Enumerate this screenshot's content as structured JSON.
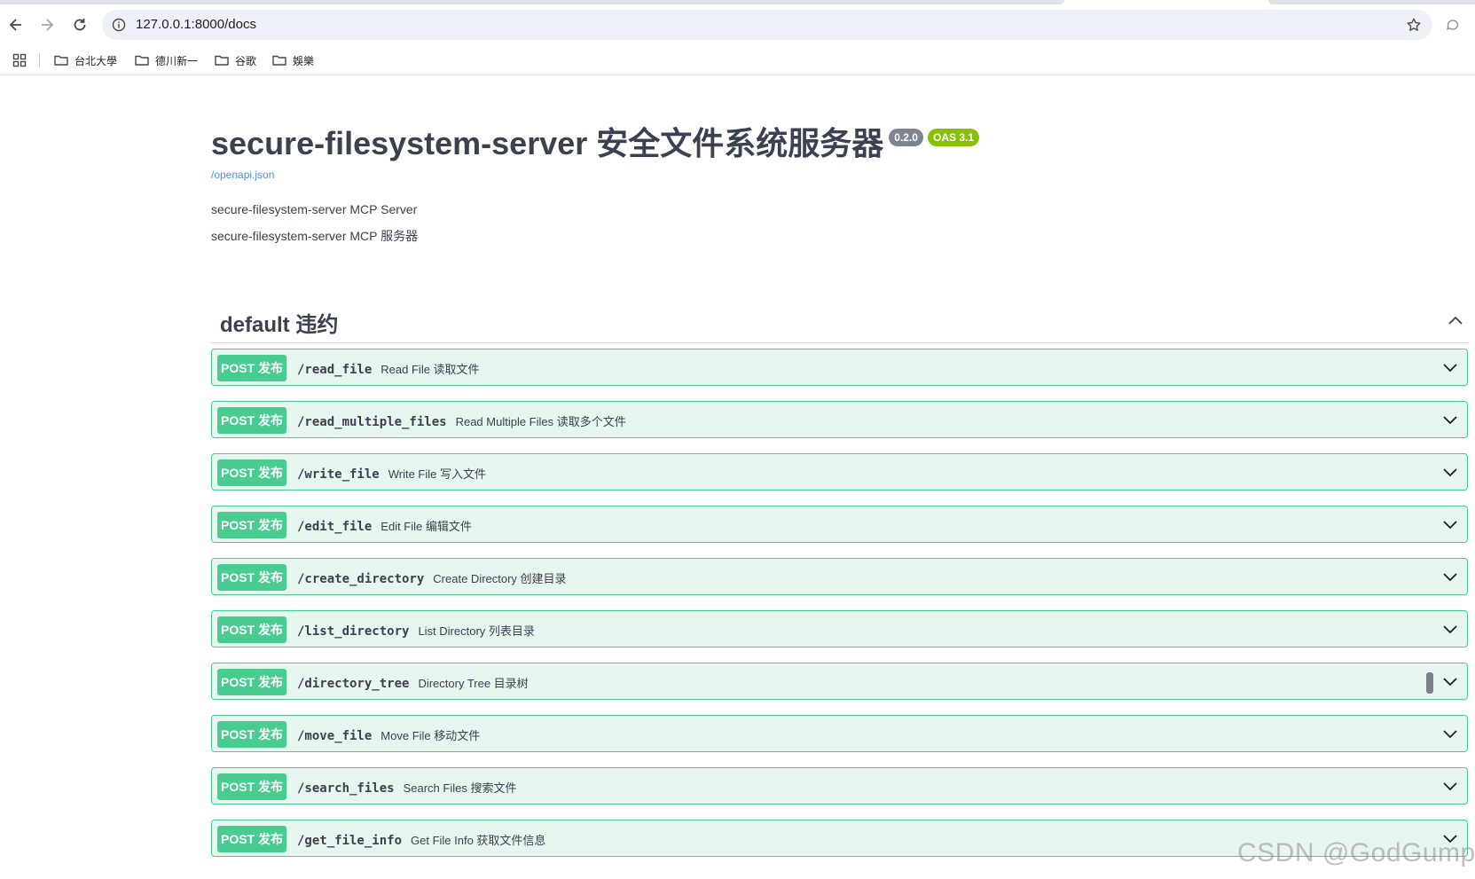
{
  "browser": {
    "url": "127.0.0.1:8000/docs",
    "bookmarks": [
      {
        "label": "台北大學"
      },
      {
        "label": "德川新一"
      },
      {
        "label": "谷歌"
      },
      {
        "label": "娛樂"
      }
    ]
  },
  "page": {
    "title": "secure-filesystem-server  安全文件系统服务器",
    "version_badge": "0.2.0",
    "oas_badge": "OAS 3.1",
    "openapi_link": "/openapi.json",
    "description_line1": "secure-filesystem-server MCP Server",
    "description_line2": "secure-filesystem-server MCP 服务器",
    "section_title": "default  违约"
  },
  "operations": [
    {
      "method": "POST 发布",
      "path": "/read_file",
      "summary": "Read File  读取文件"
    },
    {
      "method": "POST 发布",
      "path": "/read_multiple_files",
      "summary": "Read Multiple Files  读取多个文件"
    },
    {
      "method": "POST 发布",
      "path": "/write_file",
      "summary": "Write File  写入文件"
    },
    {
      "method": "POST 发布",
      "path": "/edit_file",
      "summary": "Edit File  编辑文件"
    },
    {
      "method": "POST 发布",
      "path": "/create_directory",
      "summary": "Create Directory  创建目录"
    },
    {
      "method": "POST 发布",
      "path": "/list_directory",
      "summary": "List Directory  列表目录"
    },
    {
      "method": "POST 发布",
      "path": "/directory_tree",
      "summary": "Directory Tree  目录树"
    },
    {
      "method": "POST 发布",
      "path": "/move_file",
      "summary": "Move File  移动文件"
    },
    {
      "method": "POST 发布",
      "path": "/search_files",
      "summary": "Search Files  搜索文件"
    },
    {
      "method": "POST 发布",
      "path": "/get_file_info",
      "summary": "Get File Info  获取文件信息"
    }
  ],
  "watermark": "CSDN @GodGump",
  "colors": {
    "post_border": "#49cc90",
    "post_bg": "#e8f6f0",
    "version_badge": "#7d8492",
    "oas_badge": "#89bf04",
    "link": "#4990e2"
  },
  "icons": [
    "back-icon",
    "forward-icon",
    "reload-icon",
    "info-icon",
    "star-icon",
    "chat-icon",
    "apps-icon",
    "folder-icon",
    "chevron-up-icon",
    "chevron-down-icon"
  ]
}
